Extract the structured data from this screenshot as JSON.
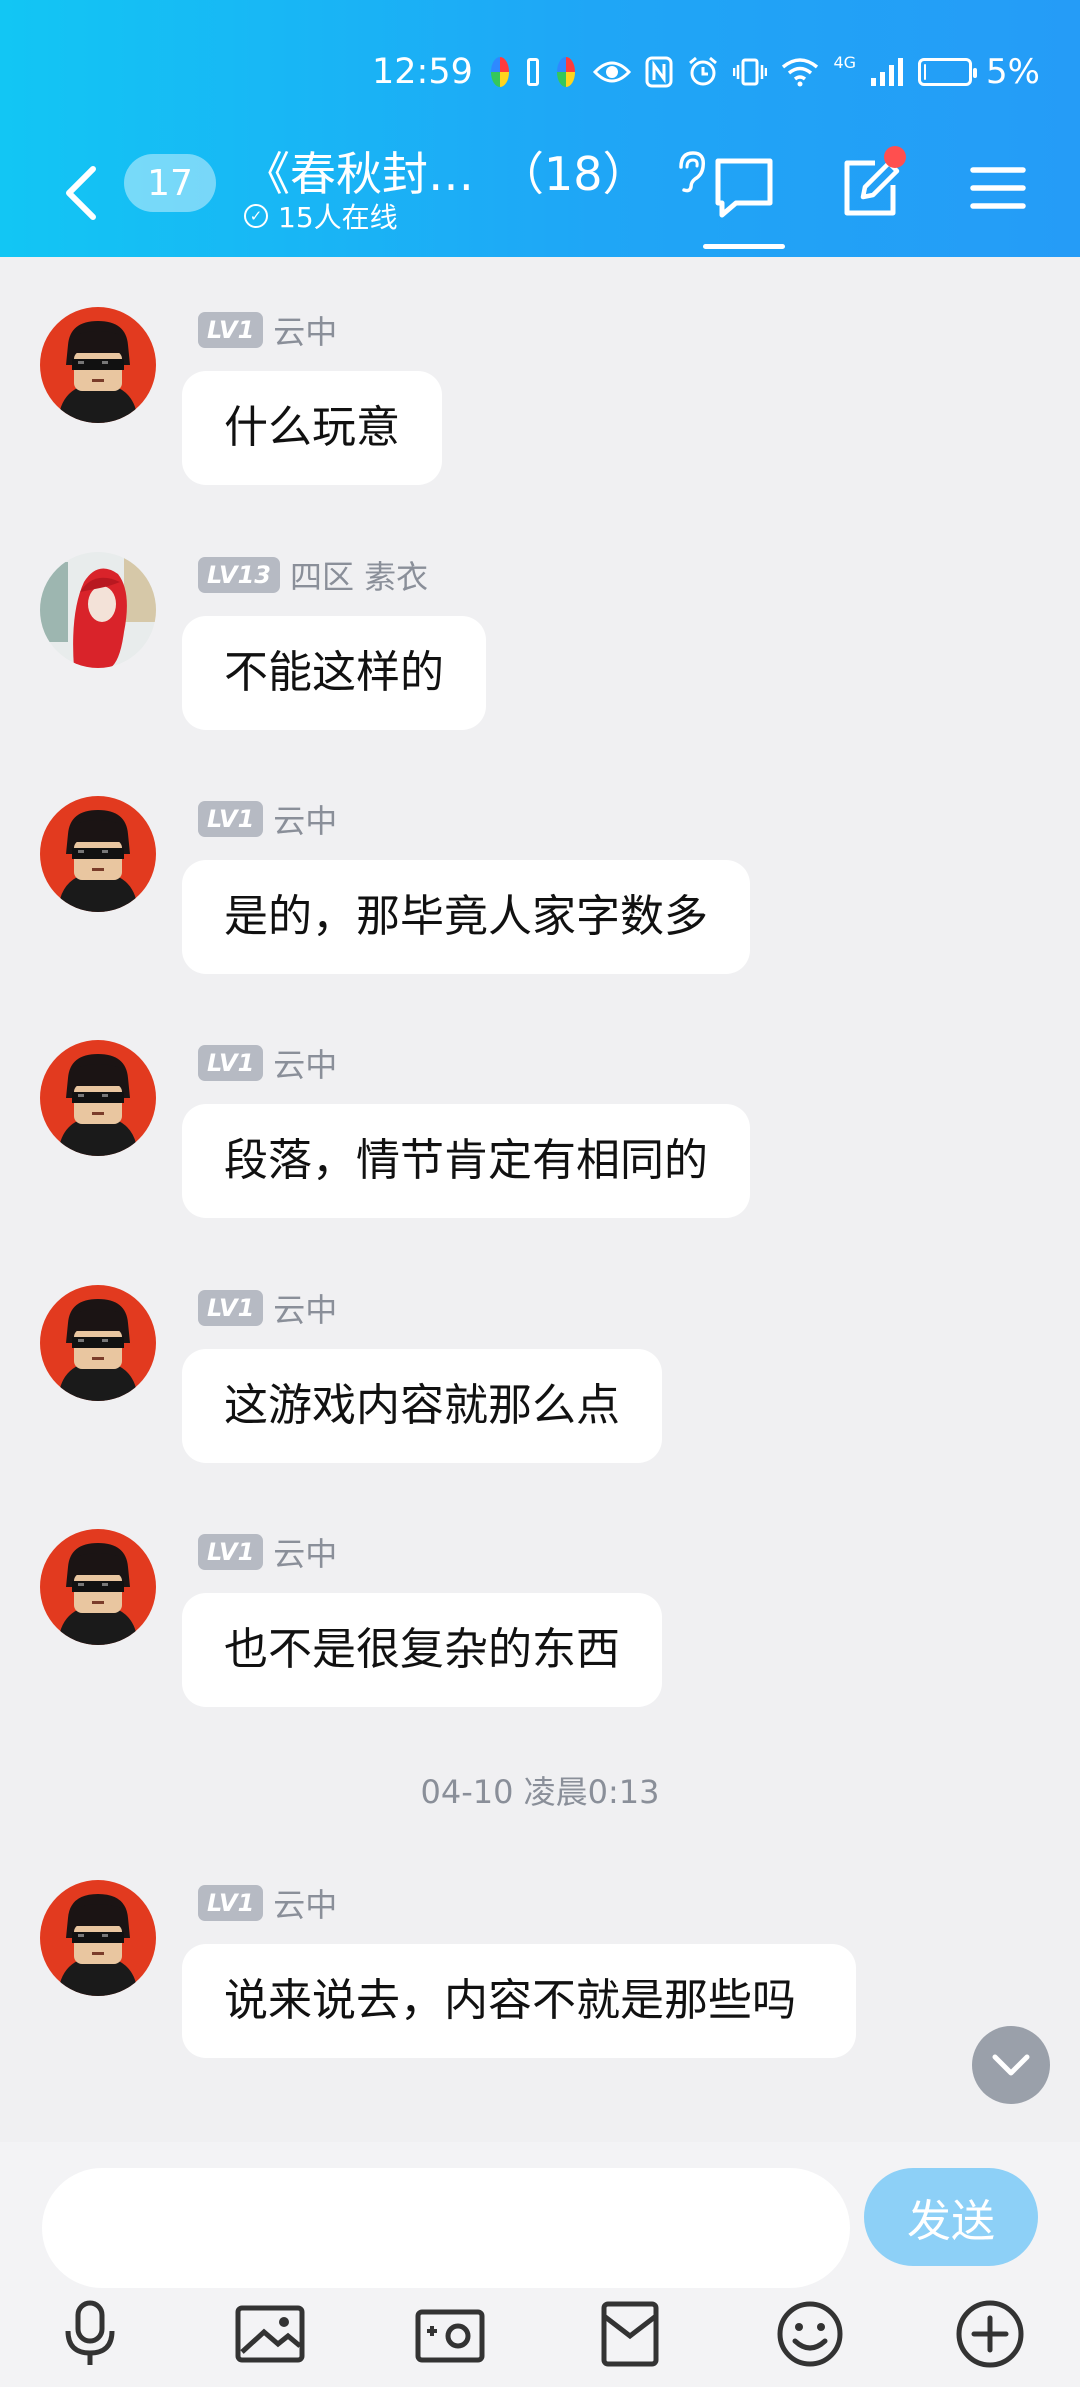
{
  "status_bar": {
    "time": "12:59",
    "network": "4G",
    "battery": "5%",
    "battery_level": 0.05
  },
  "header": {
    "unread_count": "17",
    "title": "《春秋封…",
    "member_count": "（18）",
    "online_status": "15人在线",
    "has_notification_dot": true
  },
  "messages": [
    {
      "level": "LV1",
      "name": "云中",
      "text": "什么玩意",
      "avatar": "pixel-sunglasses"
    },
    {
      "level": "LV13",
      "name": "四区 素衣",
      "text": "不能这样的",
      "avatar": "red-hair-portrait"
    },
    {
      "level": "LV1",
      "name": "云中",
      "text": "是的，那毕竟人家字数多",
      "avatar": "pixel-sunglasses"
    },
    {
      "level": "LV1",
      "name": "云中",
      "text": "段落，情节肯定有相同的",
      "avatar": "pixel-sunglasses"
    },
    {
      "level": "LV1",
      "name": "云中",
      "text": "这游戏内容就那么点",
      "avatar": "pixel-sunglasses"
    },
    {
      "level": "LV1",
      "name": "云中",
      "text": "也不是很复杂的东西",
      "avatar": "pixel-sunglasses"
    },
    {
      "level": "LV1",
      "name": "云中",
      "text": "说来说去，内容不就是那些吗",
      "avatar": "pixel-sunglasses"
    }
  ],
  "timestamp": "04-10 凌晨0:13",
  "composer": {
    "placeholder": "",
    "send_label": "发送"
  },
  "toolbar_icons": [
    "microphone-icon",
    "image-icon",
    "camera-icon",
    "red-packet-icon",
    "emoji-icon",
    "plus-icon"
  ],
  "colors": {
    "header_start": "#12c6f4",
    "header_end": "#259cf7",
    "send_button": "#8dd0f7",
    "level_badge": "#b6bac3",
    "notification_dot": "#ff4f4f"
  }
}
